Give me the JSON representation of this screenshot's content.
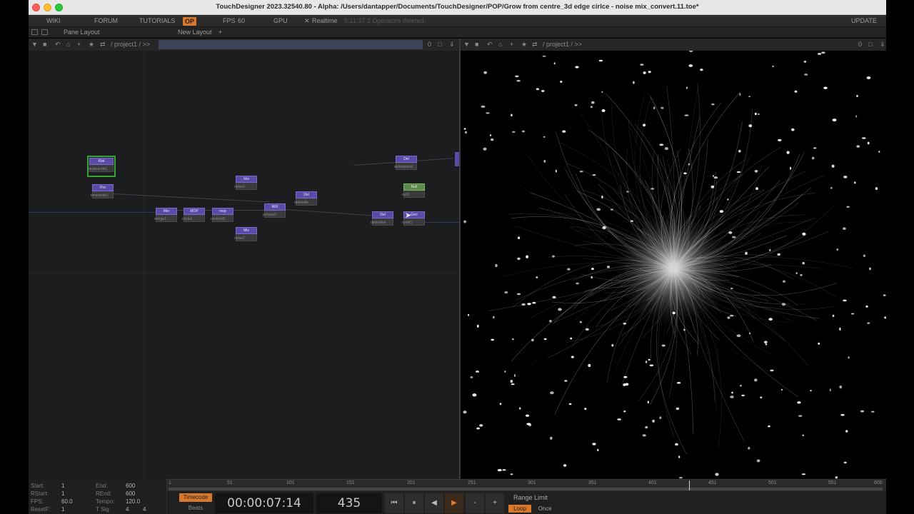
{
  "window": {
    "title": "TouchDesigner 2023.32540.80 - Alpha: /Users/dantapper/Documents/TouchDesigner/POP/Grow from centre_3d edge cirlce - noise mix_convert.11.toe*"
  },
  "menubar": {
    "wiki": "WIKI",
    "forum": "FORUM",
    "tutorials": "TUTORIALS",
    "op": "OP",
    "fps": "FPS",
    "fps_value": "60",
    "gpu": "GPU",
    "realtime": "Realtime",
    "status": "9:11:37 2 Operators deleted.",
    "update": "UPDATE"
  },
  "panebar": {
    "pane_layout": "Pane Layout",
    "new_layout": "New Layout",
    "add": "+"
  },
  "network_toolbar": {
    "path": "/ project1 / >>",
    "count": "0"
  },
  "viewer_toolbar": {
    "path": "/ project1 / >>",
    "count": "0"
  },
  "nodes": [
    {
      "id": "keyboardin1",
      "type": "Kbd",
      "label": "keyboardin1",
      "selected": true
    },
    {
      "id": "timer1",
      "type": "Pro",
      "label": "timerdesk1"
    },
    {
      "id": "noise3",
      "type": "Noi",
      "label": "noise3"
    },
    {
      "id": "merge1",
      "type": "Mer",
      "label": "merge1"
    },
    {
      "id": "circle1",
      "type": "MOP",
      "label": "circle1"
    },
    {
      "id": "edit1",
      "type": "mop",
      "label": "centroid1"
    },
    {
      "id": "mix1",
      "type": "MIX",
      "label": "pchase2"
    },
    {
      "id": "mix2",
      "type": "Mix",
      "label": "noise2"
    },
    {
      "id": "delete1",
      "type": "Del",
      "label": "deletetile"
    },
    {
      "id": "delete2",
      "type": "Del",
      "label": "deleteblend"
    },
    {
      "id": "null1",
      "type": "Null",
      "label": "null1"
    },
    {
      "id": "delete3",
      "type": "Del",
      "label": "deleteline"
    },
    {
      "id": "geo1",
      "type": "Geo",
      "label": "rendr1"
    }
  ],
  "time_info": {
    "start_label": "Start:",
    "start": "1",
    "end_label": "End:",
    "end": "600",
    "rstart_label": "RStart:",
    "rstart": "1",
    "rend_label": "REnd:",
    "rend": "600",
    "fps_label": "FPS:",
    "fps": "60.0",
    "tempo_label": "Tempo:",
    "tempo": "120.0",
    "resetf_label": "ResetF:",
    "resetf": "1",
    "tsig_label": "T Sig:",
    "tsig_a": "4",
    "tsig_b": "4"
  },
  "ruler": {
    "ticks": [
      "1",
      "51",
      "101",
      "151",
      "201",
      "251",
      "301",
      "351",
      "401",
      "451",
      "501",
      "551",
      "600"
    ]
  },
  "controls": {
    "timecode": "Timecode",
    "beats": "Beats",
    "timecode_value": "00:00:07:14",
    "frame": "435",
    "rewind": "⏮",
    "pause": "⏸",
    "step_back": "◀",
    "play": "▶",
    "minus": "-",
    "plus": "+",
    "range_limit": "Range Limit",
    "loop": "Loop",
    "once": "Once"
  },
  "colors": {
    "accent": "#d9782b",
    "op_purple": "#5b4ba8",
    "op_green": "#5e8a4a",
    "selection": "#37a333"
  }
}
